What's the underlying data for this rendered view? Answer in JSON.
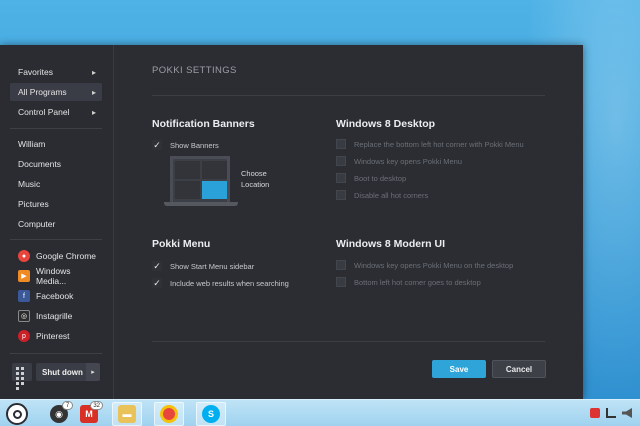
{
  "sidebar": {
    "nav": [
      {
        "label": "Favorites",
        "has_arrow": true,
        "active": false
      },
      {
        "label": "All Programs",
        "has_arrow": true,
        "active": true
      },
      {
        "label": "Control Panel",
        "has_arrow": true,
        "active": false
      }
    ],
    "places": [
      "William",
      "Documents",
      "Music",
      "Pictures",
      "Computer"
    ],
    "apps": [
      {
        "label": "Google Chrome",
        "icon": "chrome-icon",
        "color": "#e8453c"
      },
      {
        "label": "Windows Media...",
        "icon": "media-player-icon",
        "color": "#f08a24"
      },
      {
        "label": "Facebook",
        "icon": "facebook-icon",
        "color": "#3b5998"
      },
      {
        "label": "Instagrille",
        "icon": "instagram-icon",
        "color": "#2c2c2c"
      },
      {
        "label": "Pinterest",
        "icon": "pinterest-icon",
        "color": "#cb2027"
      }
    ],
    "shutdown_label": "Shut down"
  },
  "settings": {
    "title": "POKKI SETTINGS",
    "notification": {
      "heading": "Notification Banners",
      "show_banners": {
        "label": "Show Banners",
        "checked": true
      },
      "choose_location": "Choose Location"
    },
    "pokki_menu": {
      "heading": "Pokki Menu",
      "options": [
        {
          "label": "Show Start Menu sidebar",
          "checked": true
        },
        {
          "label": "Include web results when searching",
          "checked": true
        }
      ]
    },
    "win8_desktop": {
      "heading": "Windows 8 Desktop",
      "options": [
        {
          "label": "Replace the bottom left hot corner with Pokki Menu",
          "checked": false
        },
        {
          "label": "Windows key opens Pokki Menu",
          "checked": false
        },
        {
          "label": "Boot to desktop",
          "checked": false
        },
        {
          "label": "Disable all hot corners",
          "checked": false
        }
      ]
    },
    "win8_modern": {
      "heading": "Windows 8 Modern UI",
      "options": [
        {
          "label": "Windows key opens Pokki Menu on the desktop",
          "checked": false
        },
        {
          "label": "Bottom left hot corner goes to desktop",
          "checked": false
        }
      ]
    },
    "save_label": "Save",
    "cancel_label": "Cancel"
  },
  "taskbar": {
    "apps": [
      {
        "icon": "camera-app-icon",
        "badge": "7",
        "color": "#333333"
      },
      {
        "icon": "gmail-icon",
        "badge": "32",
        "color": "#d93025"
      },
      {
        "icon": "file-explorer-icon",
        "badge": "",
        "color": "#e9c25a"
      },
      {
        "icon": "chrome-icon",
        "badge": "",
        "color": "#e8453c"
      },
      {
        "icon": "skype-icon",
        "badge": "",
        "color": "#00aff0"
      }
    ]
  },
  "colors": {
    "accent": "#2ea4d9",
    "menu_bg": "#2b2d33",
    "desktop": "#3aa2dc"
  }
}
